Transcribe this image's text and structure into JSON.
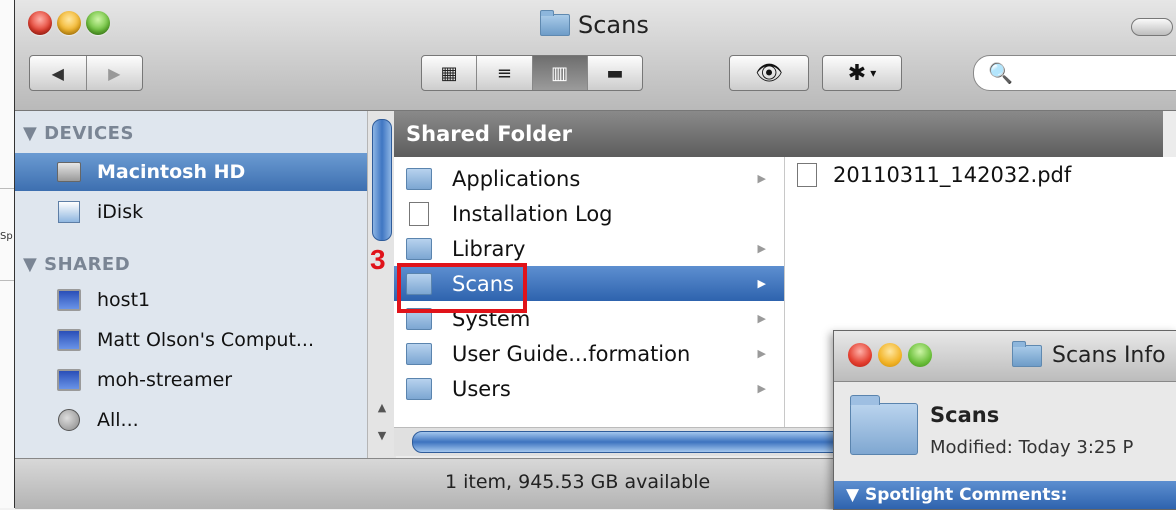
{
  "background": {
    "partial_label": "Sp"
  },
  "window": {
    "title": "Scans"
  },
  "toolbar": {
    "back": "◀",
    "forward": "▶",
    "views": [
      "▦",
      "≡",
      "▥",
      "▬"
    ],
    "quicklook": "👁",
    "action": "✱",
    "action_menu": "▾",
    "search_icon": "🔍",
    "search_value": "",
    "search_placeholder": ""
  },
  "sidebar": {
    "devices_header": "▼ DEVICES",
    "devices": [
      {
        "label": "Macintosh HD",
        "icon": "hard-drive-icon",
        "selected": true
      },
      {
        "label": "iDisk",
        "icon": "idisk-icon"
      }
    ],
    "shared_header": "▼ SHARED",
    "shared": [
      {
        "label": "host1",
        "icon": "monitor-icon"
      },
      {
        "label": "Matt Olson's Comput...",
        "icon": "laptop-icon"
      },
      {
        "label": "moh-streamer",
        "icon": "monitor-icon"
      },
      {
        "label": "All...",
        "icon": "globe-icon"
      }
    ]
  },
  "column_header": "Shared Folder",
  "column1": [
    {
      "label": "Applications",
      "arrow": "▶"
    },
    {
      "label": "Installation Log",
      "arrow": ""
    },
    {
      "label": "Library",
      "arrow": "▶"
    },
    {
      "label": "Scans",
      "arrow": "▶",
      "selected": true
    },
    {
      "label": "System",
      "arrow": "▶"
    },
    {
      "label": "User Guide...formation",
      "arrow": "▶"
    },
    {
      "label": "Users",
      "arrow": "▶"
    }
  ],
  "column2": [
    {
      "label": "20110311_142032.pdf"
    }
  ],
  "annotation": {
    "step": "3"
  },
  "status": "1 item, 945.53 GB available",
  "info_window": {
    "title": "Scans Info",
    "name": "Scans",
    "modified": "Modified: Today 3:25 P",
    "spotlight": "▼ Spotlight Comments:"
  },
  "colors": {
    "selection": "#3d6fb0",
    "highlight": "#e0131a",
    "sidebar_bg": "#dfe6ee"
  }
}
